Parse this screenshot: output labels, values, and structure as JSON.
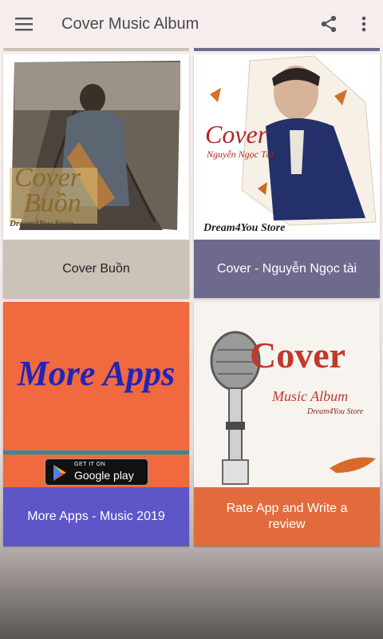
{
  "app_bar": {
    "title": "Cover Music Album",
    "menu_icon": "hamburger-menu-icon",
    "share_icon": "share-icon",
    "more_icon": "more-vert-icon"
  },
  "cards": [
    {
      "label": "Cover Buồn",
      "label_bg": "#cbc2b8",
      "label_color": "#222222",
      "art_title_line1": "Cover",
      "art_title_line2": "Buồn",
      "art_brand": "Dream4You Store"
    },
    {
      "label": "Cover - Nguyễn Ngọc tài",
      "label_bg": "#6d6a8e",
      "label_color": "#ffffff",
      "art_title": "Cover",
      "art_subtitle": "Nguyễn Ngọc Tài",
      "art_brand": "Dream4You Store"
    },
    {
      "label": "More Apps - Music 2019",
      "label_bg": "#5e56c6",
      "label_color": "#ffffff",
      "art_title": "More Apps",
      "badge_small": "GET IT ON",
      "badge_big": "Google play"
    },
    {
      "label": "Rate App and Write a review",
      "label_bg": "#e26b3d",
      "label_color": "#ffffff",
      "art_title": "Cover",
      "art_subtitle": "Music Album",
      "art_brand": "Dream4You Store"
    }
  ]
}
